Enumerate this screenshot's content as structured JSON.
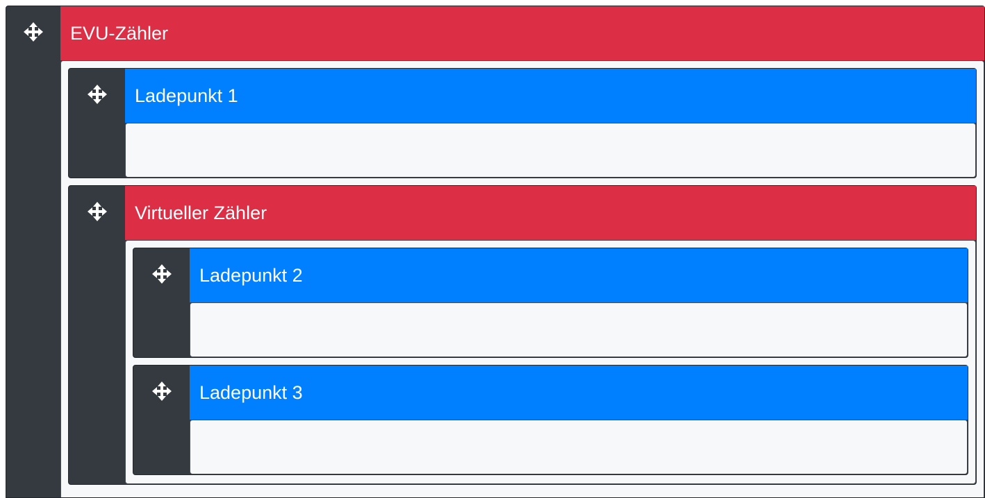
{
  "tree": {
    "root": {
      "title": "EVU-Zähler",
      "color": "#dc2f46",
      "icon": "move-icon",
      "children": [
        {
          "title": "Ladepunkt 1",
          "color": "#0080ff",
          "icon": "move-icon"
        },
        {
          "title": "Virtueller Zähler",
          "color": "#dc2f46",
          "icon": "move-icon",
          "children": [
            {
              "title": "Ladepunkt 2",
              "color": "#0080ff",
              "icon": "move-icon"
            },
            {
              "title": "Ladepunkt 3",
              "color": "#0080ff",
              "icon": "move-icon"
            }
          ]
        }
      ]
    }
  },
  "colors": {
    "handle_bg": "#343a40",
    "counter": "#dc2f46",
    "chargepoint": "#0080ff",
    "body_bg": "#f7f8fa"
  }
}
